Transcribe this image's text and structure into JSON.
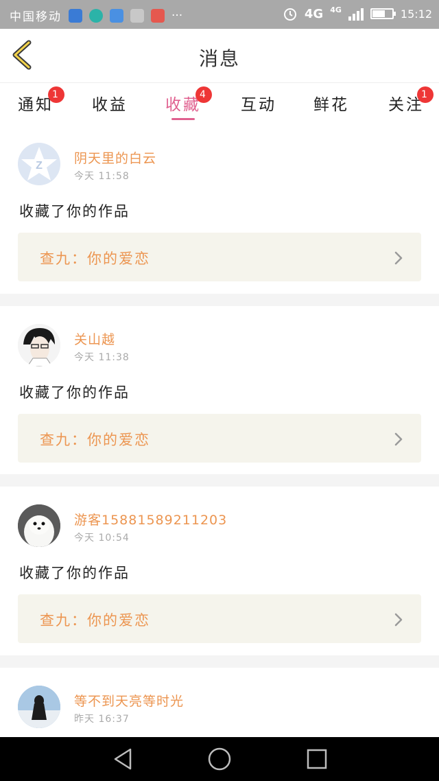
{
  "status_bar": {
    "carrier": "中国移动",
    "extra": "···",
    "network": "4G",
    "network_small": "4G",
    "time": "15:12"
  },
  "header": {
    "title": "消息"
  },
  "tabs": [
    {
      "label": "通知",
      "badge": "1"
    },
    {
      "label": "收益",
      "badge": ""
    },
    {
      "label": "收藏",
      "badge": "4",
      "active": true
    },
    {
      "label": "互动",
      "badge": ""
    },
    {
      "label": "鲜花",
      "badge": ""
    },
    {
      "label": "关注",
      "badge": "1"
    }
  ],
  "items": [
    {
      "user": "阴天里的白云",
      "time": "今天 11:58",
      "action": "收藏了你的作品",
      "work": "查九：你的爱恋"
    },
    {
      "user": "关山越",
      "time": "今天 11:38",
      "action": "收藏了你的作品",
      "work": "查九：你的爱恋"
    },
    {
      "user": "游客15881589211203",
      "time": "今天 10:54",
      "action": "收藏了你的作品",
      "work": "查九：你的爱恋"
    },
    {
      "user": "等不到天亮等时光",
      "time": "昨天 16:37"
    }
  ],
  "colors": {
    "accent": "#e0608f",
    "orange": "#ec9550",
    "badge": "#ee3636"
  },
  "icons": [
    "back-chevron-icon",
    "chevron-right-icon",
    "nav-back-icon",
    "nav-home-icon",
    "nav-recents-icon"
  ]
}
